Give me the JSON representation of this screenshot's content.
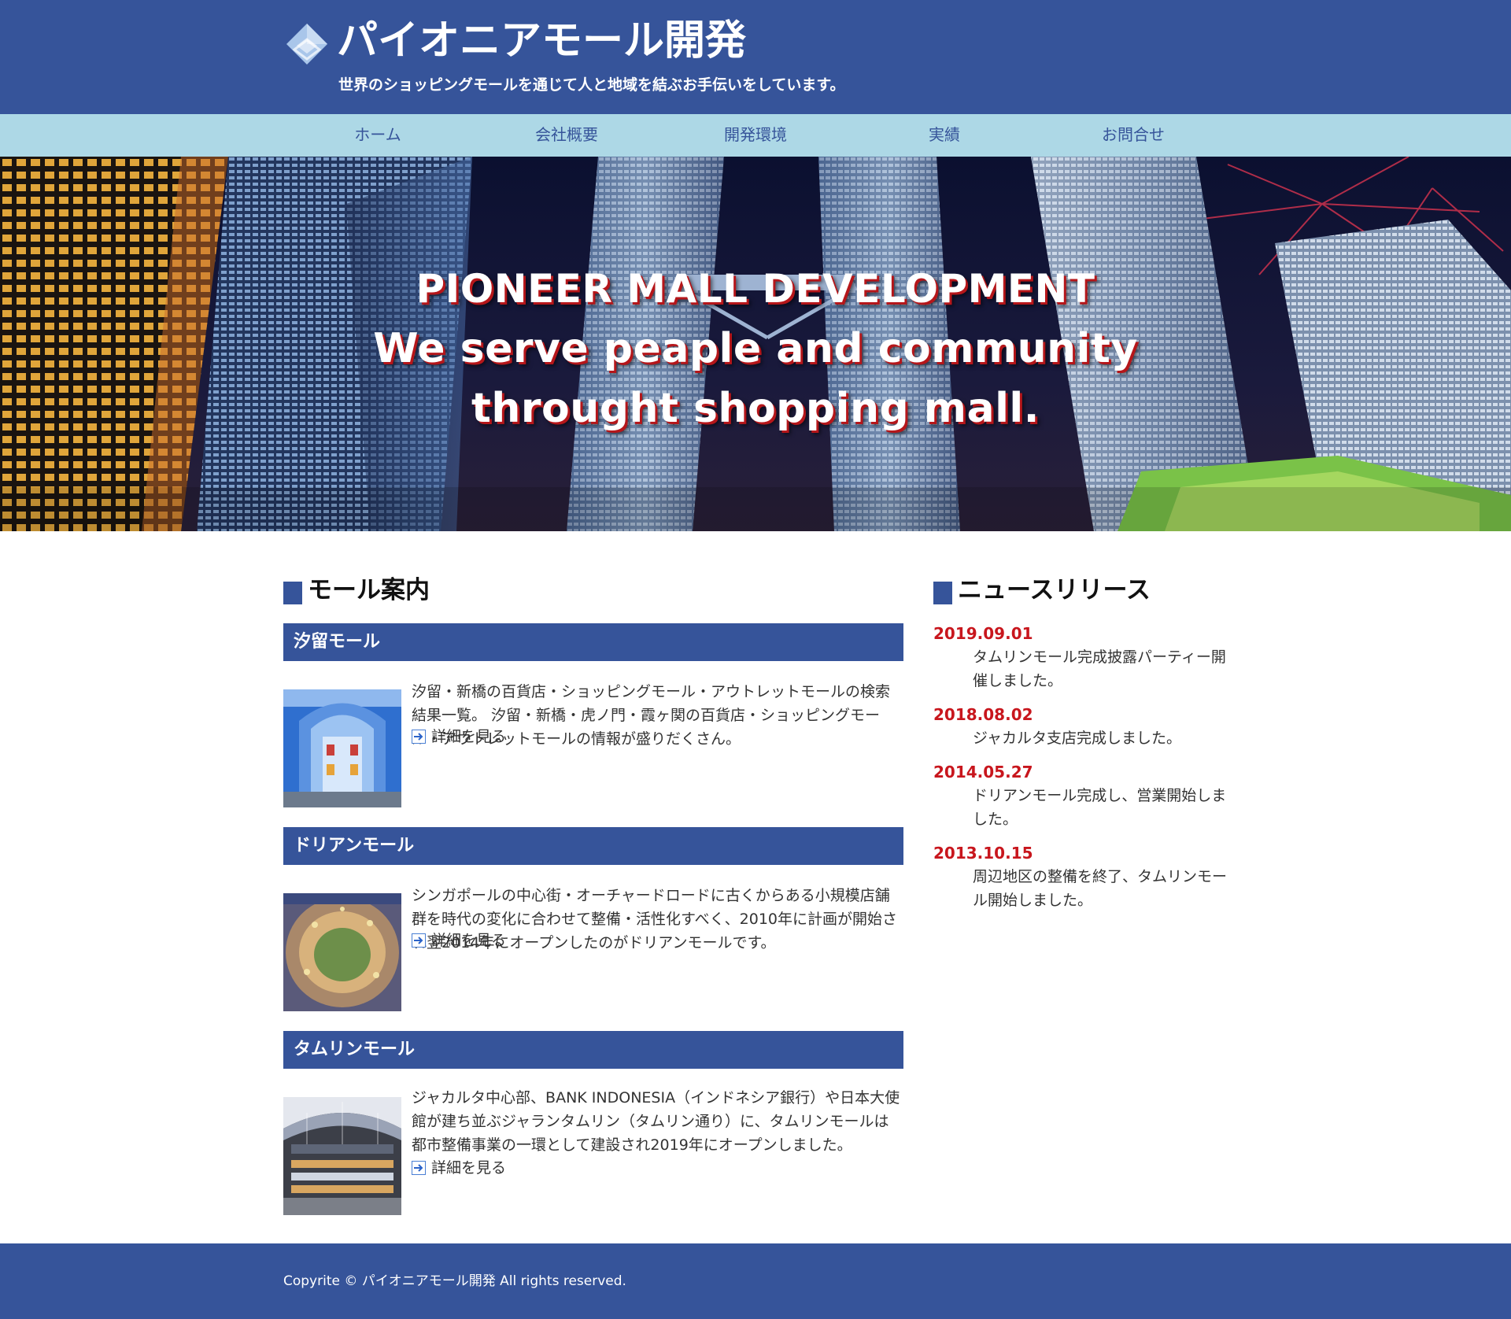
{
  "header": {
    "title": "パイオニアモール開発",
    "tagline": "世界のショッピングモールを通じて人と地域を結ぶお手伝いをしています。"
  },
  "nav": {
    "items": [
      "ホーム",
      "会社概要",
      "開発環境",
      "実績",
      "お問合せ"
    ]
  },
  "hero": {
    "lines": [
      "PIONEER MALL DEVELOPMENT",
      "We serve peaple and community",
      "throught shopping mall."
    ]
  },
  "main": {
    "mall_heading": "モール案内",
    "malls": [
      {
        "title": "汐留モール",
        "description": "汐留・新橋の百貨店・ショッピングモール・アウトレットモールの検索結果一覧。 汐留・新橋・虎ノ門・霞ヶ関の百貨店・ショッピングモール・アウトレットモールの情報が盛りだくさん。",
        "link": "詳細を見る"
      },
      {
        "title": "ドリアンモール",
        "description": "シンガポールの中心街・オーチャードロードに古くからある小規模店舗群を時代の変化に合わせて整備・活性化すべく、2010年に計画が開始され翌2014年にオープンしたのがドリアンモールです。",
        "link": "詳細を見る"
      },
      {
        "title": "タムリンモール",
        "description": "ジャカルタ中心部、BANK INDONESIA（インドネシア銀行）や日本大使館が建ち並ぶジャランタムリン（タムリン通り）に、タムリンモールは都市整備事業の一環として建設され2019年にオープンしました。",
        "link": "詳細を見る"
      }
    ]
  },
  "news": {
    "heading": "ニュースリリース",
    "items": [
      {
        "date": "2019.09.01",
        "text": "タムリンモール完成披露パーティー開催しました。"
      },
      {
        "date": "2018.08.02",
        "text": "ジャカルタ支店完成しました。"
      },
      {
        "date": "2014.05.27",
        "text": "ドリアンモール完成し、営業開始しました。"
      },
      {
        "date": "2013.10.15",
        "text": "周辺地区の整備を終了、タムリンモール開始しました。"
      }
    ]
  },
  "footer": {
    "copyright": "Copyrite © パイオニアモール開発 All rights reserved."
  },
  "colors": {
    "brand": "#36549a",
    "nav_bg": "#add8e6",
    "news_date": "#c8161d"
  },
  "icons": [
    "logo-diamond-icon",
    "arrow-right-icon"
  ]
}
